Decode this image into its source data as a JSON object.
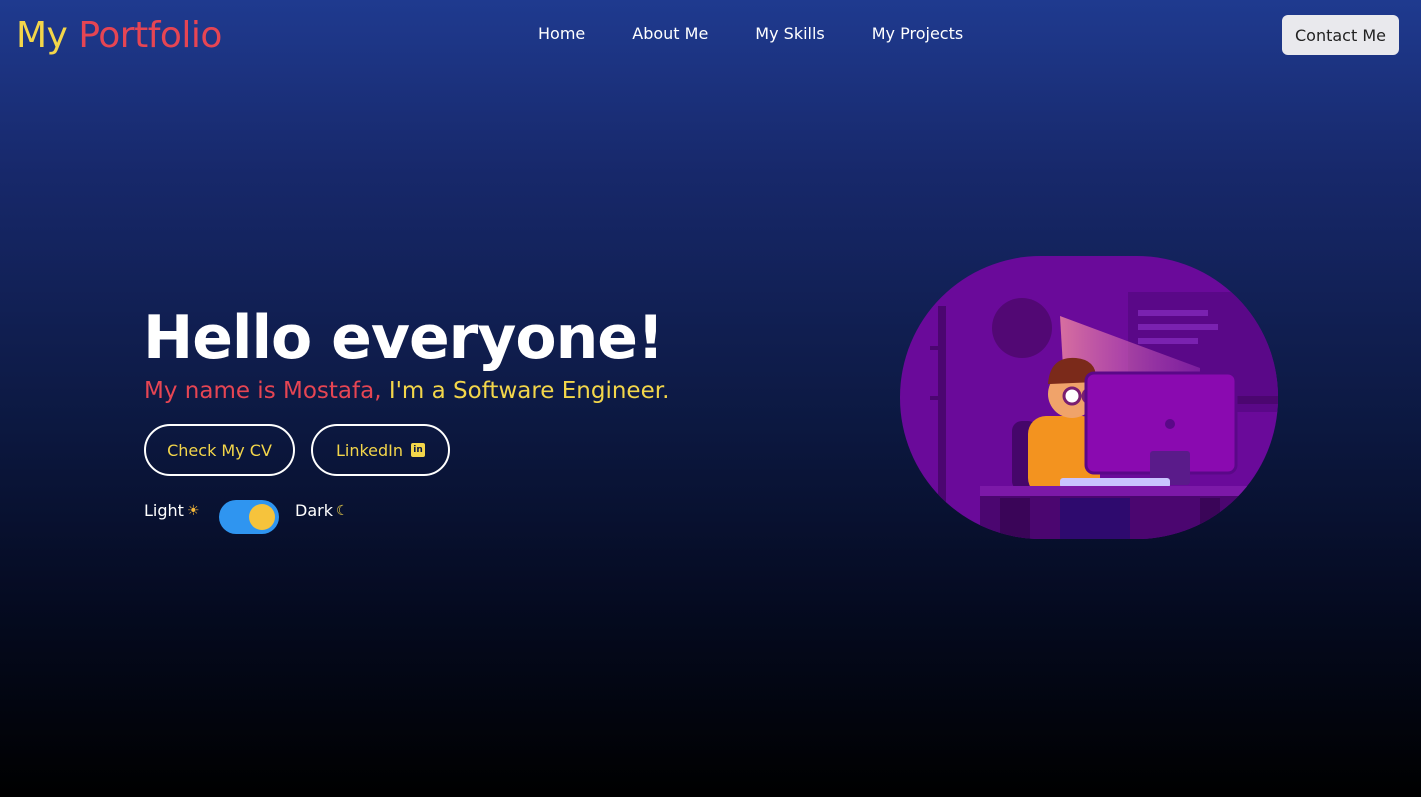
{
  "brand": {
    "part1": "My",
    "part2": "Portfolio"
  },
  "nav": {
    "items": [
      {
        "label": "Home"
      },
      {
        "label": "About Me"
      },
      {
        "label": "My Skills"
      },
      {
        "label": "My Projects"
      }
    ],
    "contact_label": "Contact Me"
  },
  "hero": {
    "title": "Hello everyone!",
    "tagline_part1": "My name is Mostafa,",
    "tagline_part2": "I'm a Software Engineer.",
    "cv_button": "Check My CV",
    "linkedin_button": "LinkedIn",
    "linkedin_icon_text": "in",
    "linkedin_icon": "linkedin-icon"
  },
  "theme": {
    "light_label": "Light",
    "dark_label": "Dark",
    "light_icon": "sun-icon",
    "dark_icon": "moon-icon",
    "state": "dark"
  },
  "colors": {
    "accent_yellow": "#f3d64a",
    "accent_red": "#e64553",
    "toggle_blue": "#2f95f0",
    "illustration_purple": "#6a0a9a"
  }
}
